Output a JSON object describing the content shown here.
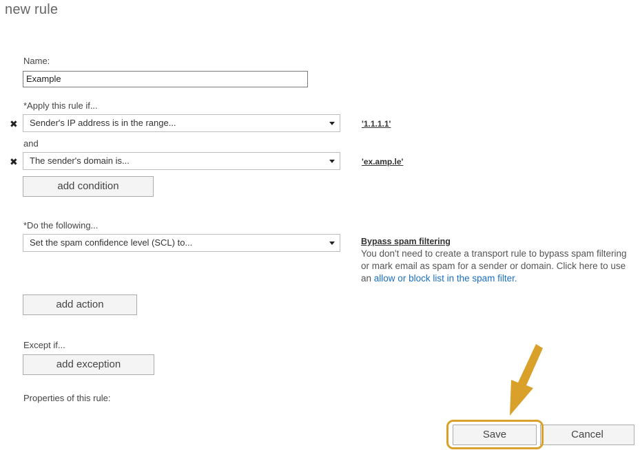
{
  "page": {
    "title": "new rule"
  },
  "name_field": {
    "label": "Name:",
    "value": "Example"
  },
  "conditions": {
    "label": "*Apply this rule if...",
    "items": [
      {
        "value": "Sender's IP address is in the range...",
        "link": "'1.1.1.1'"
      },
      {
        "value": "The sender's domain is...",
        "link": "'ex.amp.le'"
      }
    ],
    "joiner": "and",
    "add_label": "add condition",
    "remove_icon": "close-x-icon"
  },
  "actions": {
    "label": "*Do the following...",
    "items": [
      {
        "value": "Set the spam confidence level (SCL) to..."
      }
    ],
    "add_label": "add action",
    "hint": {
      "title": "Bypass spam filtering",
      "text": "You don't need to create a transport rule to bypass spam filtering or mark email as spam for a sender or domain. Click here to use an",
      "link": "allow or block list in the spam filter."
    }
  },
  "exceptions": {
    "label": "Except if...",
    "add_label": "add exception"
  },
  "properties": {
    "label": "Properties of this rule:"
  },
  "footer": {
    "save_label": "Save",
    "cancel_label": "Cancel"
  },
  "annotation": {
    "arrow_icon": "arrow-down-left-icon",
    "highlight_color": "#d9a12a"
  }
}
